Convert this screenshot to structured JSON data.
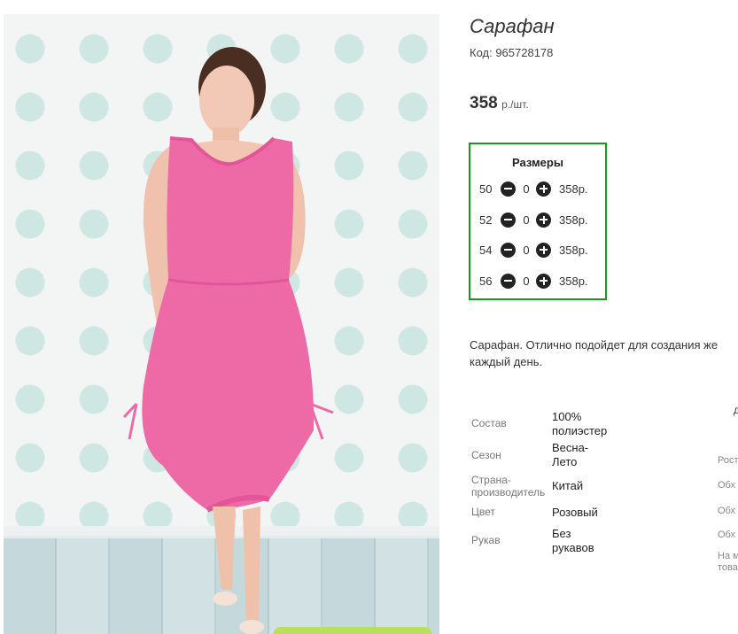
{
  "product": {
    "title": "Сарафан",
    "code": "Код: 965728178",
    "price": "358",
    "price_unit": "р./шт.",
    "image_alt": "Pink sleeveless sundress on model"
  },
  "sizes": {
    "heading": "Размеры",
    "rows": [
      {
        "size": "50",
        "qty": "0",
        "price": "358р."
      },
      {
        "size": "52",
        "qty": "0",
        "price": "358р."
      },
      {
        "size": "54",
        "qty": "0",
        "price": "358р."
      },
      {
        "size": "56",
        "qty": "0",
        "price": "358р."
      }
    ]
  },
  "description": {
    "line1": "Сарафан. Отлично подойдет для создания же",
    "line2": "каждый день."
  },
  "properties": [
    {
      "label": "Состав",
      "value1": "100%",
      "value2": "полиэстер"
    },
    {
      "label": "Сезон",
      "value1": "Весна-",
      "value2": "Лето"
    },
    {
      "label1": "Страна-",
      "label2": "производитель",
      "value1": "Китай"
    },
    {
      "label": "Цвет",
      "value1": "Розовый"
    },
    {
      "label": "Рукав",
      "value1": "Без",
      "value2": "рукавов"
    }
  ],
  "right_column": [
    "д",
    "Рост",
    "Обх",
    "Обх",
    "Обх",
    "На м",
    "това"
  ],
  "colors": {
    "accent_border": "#199a1a",
    "dress": "#ee6aa7"
  }
}
